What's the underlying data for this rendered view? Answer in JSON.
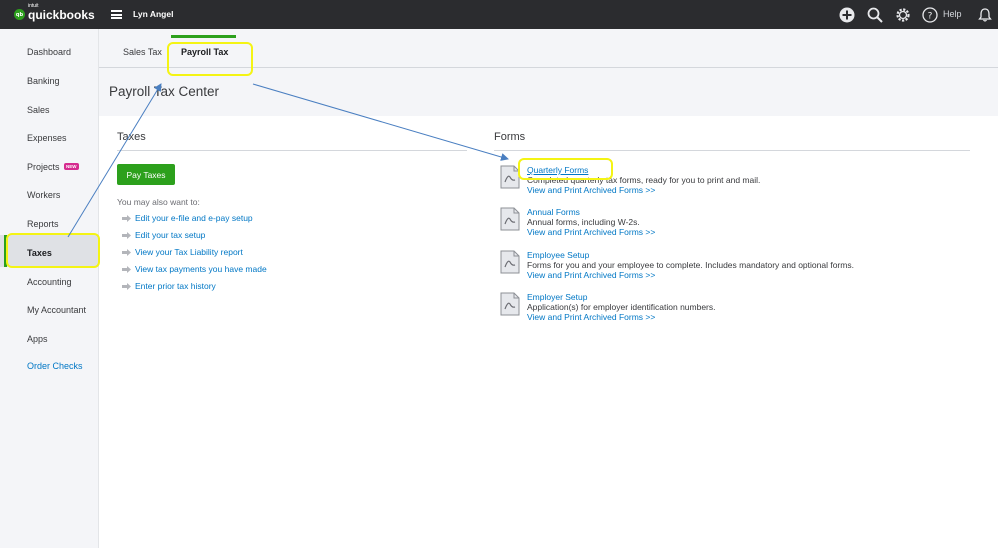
{
  "app": {
    "brand_small": "intuit",
    "brand_name": "quickbooks",
    "company_name": "Lyn Angel",
    "help_label": "Help"
  },
  "sidebar": {
    "items": [
      {
        "label": "Dashboard"
      },
      {
        "label": "Banking"
      },
      {
        "label": "Sales"
      },
      {
        "label": "Expenses"
      },
      {
        "label": "Projects",
        "badge": "NEW"
      },
      {
        "label": "Workers"
      },
      {
        "label": "Reports"
      },
      {
        "label": "Taxes",
        "active": true
      },
      {
        "label": "Accounting"
      },
      {
        "label": "My Accountant"
      },
      {
        "label": "Apps"
      },
      {
        "label": "Order Checks",
        "link": true
      }
    ]
  },
  "tabs": [
    {
      "label": "Sales Tax"
    },
    {
      "label": "Payroll Tax",
      "active": true
    }
  ],
  "page_title": "Payroll Tax Center",
  "taxes": {
    "title": "Taxes",
    "pay_button": "Pay Taxes",
    "also_title": "You may also want to:",
    "links": [
      "Edit your e-file and e-pay setup",
      "Edit your tax setup",
      "View your Tax Liability report",
      "View tax payments you have made",
      "Enter prior tax history"
    ]
  },
  "forms": {
    "title": "Forms",
    "items": [
      {
        "name": "Quarterly Forms",
        "desc": "Completed quarterly tax forms, ready for you to print and mail.",
        "link": "View and Print Archived Forms >>"
      },
      {
        "name": "Annual Forms",
        "desc": "Annual forms, including W-2s.",
        "link": "View and Print Archived Forms >>"
      },
      {
        "name": "Employee Setup",
        "desc": "Forms for you and your employee to complete. Includes mandatory and optional forms.",
        "link": "View and Print Archived Forms >>"
      },
      {
        "name": "Employer Setup",
        "desc": "Application(s) for employer identification numbers.",
        "link": "View and Print Archived Forms >>"
      }
    ]
  },
  "colors": {
    "accent_green": "#2ca01c",
    "link_blue": "#0077c5",
    "highlight_yellow": "#f4f414",
    "annotation_arrow": "#4a7fc1",
    "topbar": "#2b2c2f"
  }
}
